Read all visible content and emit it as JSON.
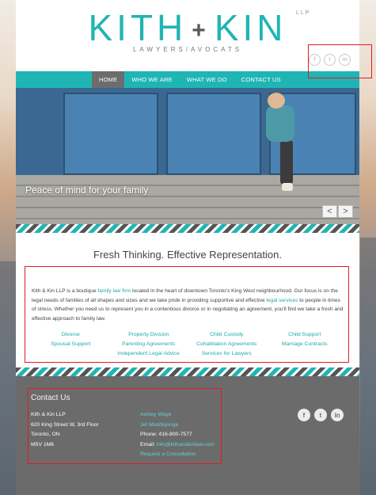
{
  "header": {
    "logo_left": "KITH",
    "logo_plus": "+",
    "logo_right": "KIN",
    "logo_suffix": "LLP",
    "tagline_left": "LAWYERS",
    "tagline_slash": "/",
    "tagline_right": "AVOCATS"
  },
  "social": {
    "facebook_glyph": "f",
    "twitter_glyph": "t",
    "linkedin_glyph": "in",
    "icons": [
      "facebook-icon",
      "twitter-icon",
      "linkedin-icon"
    ]
  },
  "nav": {
    "items": [
      {
        "label": "HOME"
      },
      {
        "label": "WHO WE ARE"
      },
      {
        "label": "WHAT WE DO"
      },
      {
        "label": "CONTACT US"
      }
    ]
  },
  "hero": {
    "caption": "Peace of mind for your family",
    "prev_glyph": "<",
    "next_glyph": ">"
  },
  "headline": "Fresh Thinking. Effective Representation.",
  "intro": {
    "p1": "Kith & Kin LLP is a boutique ",
    "link1": "family law firm",
    "p2": " located in the heart of downtown Toronto's King West neighbourhood.  Our focus is on the legal needs of families of all shapes and sizes and we take pride in providing supportive and effective ",
    "link2": "legal services",
    "p3": " to people in times of stress.  Whether you need us to represent you in a contentious divorce or in negotiating an agreement, you'll find we take a fresh and effective approach to family law."
  },
  "services": [
    "Divorce",
    "Property Division",
    "Child Custody",
    "Child Support",
    "Spousal Support",
    "Parenting Agreements",
    "Cohabitation Agreements",
    "Marriage Contracts",
    "Independent Legal Advice",
    "Services for Lawyers"
  ],
  "footer": {
    "title": "Contact Us",
    "firm": "Kith & Kin LLP",
    "address1": "620 King Street W, 3rd Floor",
    "city": "Toronto, ON",
    "postal": "M5V 1M6",
    "person1": "Ashley Waye",
    "person2": "Jef Moddejonge",
    "phone": "Phone: 416-800-7577",
    "email_label": "Email: ",
    "email": "info@kithandkinlaw.com",
    "consult": "Request a Consultation"
  },
  "colors": {
    "accent": "#1fb5b4",
    "nav_active": "#6d6d6d",
    "footer_bg": "#6b6b6b",
    "highlight": "#e31b23"
  }
}
